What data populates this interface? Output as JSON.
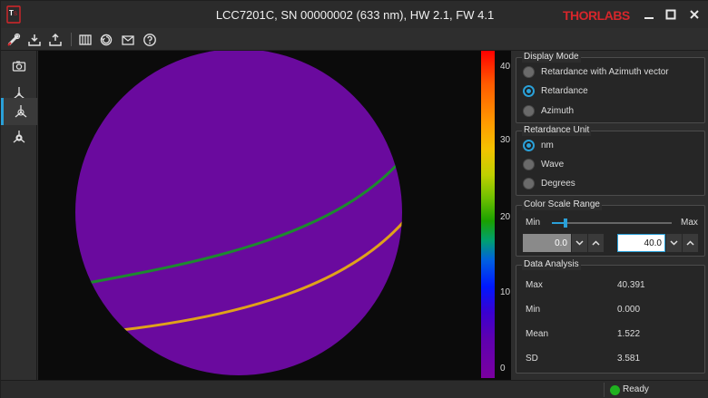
{
  "window": {
    "title": "LCC7201C, SN 00000002 (633 nm), HW 2.1, FW 4.1",
    "brand": "THORLABS"
  },
  "toolbar": {
    "buttons": [
      {
        "icon": "device-connect-icon"
      },
      {
        "icon": "load-icon"
      },
      {
        "icon": "save-icon"
      },
      {
        "icon": "grid-icon"
      },
      {
        "icon": "refresh-icon"
      },
      {
        "icon": "contact-icon"
      },
      {
        "icon": "help-icon"
      }
    ]
  },
  "sidebar": {
    "buttons": [
      {
        "icon": "camera-icon",
        "active": false
      },
      {
        "icon": "optics-icon",
        "active": false
      },
      {
        "icon": "retardance-icon",
        "active": true
      },
      {
        "icon": "analysis-icon",
        "active": false
      }
    ]
  },
  "plot": {
    "colorbar_ticks": [
      "40",
      "30",
      "20",
      "10",
      "0"
    ],
    "colors": {
      "disk": "#6a0a9e",
      "line_upper": "#1d8a2e",
      "line_lower": "#e0a21a"
    }
  },
  "display_mode": {
    "title": "Display Mode",
    "options": [
      "Retardance with Azimuth vector",
      "Retardance",
      "Azimuth"
    ],
    "selected_index": 1
  },
  "retardance_unit": {
    "title": "Retardance Unit",
    "options": [
      "nm",
      "Wave",
      "Degrees"
    ],
    "selected_index": 0
  },
  "color_scale": {
    "title": "Color Scale Range",
    "min_label": "Min",
    "max_label": "Max",
    "min_value": "0.0",
    "max_value": "40.0"
  },
  "data_analysis": {
    "title": "Data Analysis",
    "rows": [
      {
        "label": "Max",
        "value": "40.391"
      },
      {
        "label": "Min",
        "value": "0.000"
      },
      {
        "label": "Mean",
        "value": "1.522"
      },
      {
        "label": "SD",
        "value": "3.581"
      }
    ]
  },
  "status": {
    "text": "Ready",
    "color": "#1fb11f"
  }
}
